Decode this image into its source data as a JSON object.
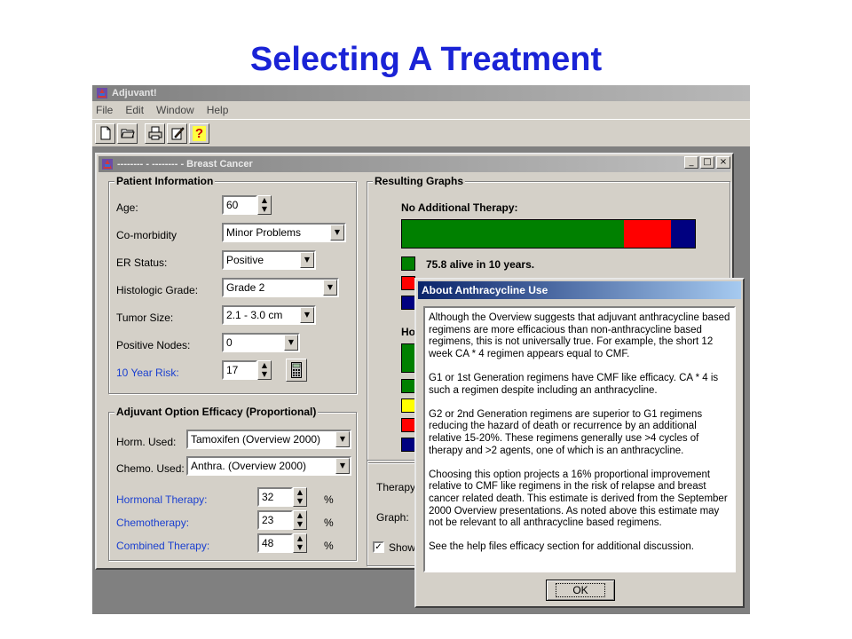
{
  "slide_title": "Selecting A Treatment",
  "app": {
    "title": "Adjuvant!",
    "menu": [
      "File",
      "Edit",
      "Window",
      "Help"
    ],
    "toolbar": [
      "new-file-icon",
      "open-file-icon",
      "print-icon",
      "edit-icon",
      "help-icon"
    ],
    "toolbar_help_glyph": "?"
  },
  "doc": {
    "title": "-------- - -------- - Breast Cancer",
    "win_buttons": [
      "_",
      "□",
      "×"
    ]
  },
  "patient": {
    "group_label": "Patient Information",
    "age_label": "Age:",
    "age": "60",
    "comorbidity_label": "Co-morbidity",
    "comorbidity": "Minor Problems",
    "er_label": "ER Status:",
    "er": "Positive",
    "grade_label": "Histologic Grade:",
    "grade": "Grade 2",
    "tumor_label": "Tumor Size:",
    "tumor": "2.1 - 3.0 cm",
    "nodes_label": "Positive Nodes:",
    "nodes": "0",
    "risk_label": "10 Year Risk:",
    "risk": "17"
  },
  "efficacy": {
    "group_label": "Adjuvant Option Efficacy (Proportional)",
    "horm_used_label": "Horm. Used:",
    "horm_used": "Tamoxifen (Overview 2000)",
    "chemo_used_label": "Chemo. Used:",
    "chemo_used": "Anthra. (Overview 2000)",
    "hormonal_label": "Hormonal Therapy:",
    "hormonal": "32",
    "chemo_label": "Chemotherapy:",
    "chemo": "23",
    "combined_label": "Combined Therapy:",
    "combined": "48",
    "pct": "%"
  },
  "graphs": {
    "group_label": "Resulting Graphs",
    "no_therapy_label": "No Additional Therapy:",
    "segments": [
      {
        "value": 75.8,
        "color": "#008000"
      },
      {
        "value": 15.9,
        "color": "#ff0000"
      },
      {
        "value": 8.3,
        "color": "#000080"
      }
    ],
    "alive_text": "75.8 alive in 10 years.",
    "with_therapy_label_partial": "Ho",
    "legend_colors": [
      "#008000",
      "#ff0000",
      "#000080"
    ],
    "legend2_colors": [
      "#008000",
      "#008000",
      "#ffff00",
      "#ff0000",
      "#000080"
    ],
    "therapy_label_partial": "Therapy",
    "graph_label": "Graph:",
    "show_label_partial": "Show",
    "show_checked": true
  },
  "dialog": {
    "title": "About Anthracycline Use",
    "paragraphs": [
      "Although the Overview suggests that adjuvant anthracycline based regimens are more efficacious than non-anthracycline based regimens, this is not universally true. For example, the short 12 week CA * 4 regimen appears equal to CMF.",
      "G1 or 1st Generation regimens have CMF like efficacy. CA * 4 is such a regimen despite including an anthracycline.",
      "G2 or 2nd Generation regimens are superior to G1 regimens reducing the hazard of death or recurrence by an additional relative 15-20%. These regimens generally use >4 cycles of therapy and >2 agents, one of which is an anthracycline.",
      "Choosing this option projects a 16% proportional improvement relative to CMF like regimens in the risk of relapse and breast cancer related death. This estimate is derived from the September 2000 Overview presentations.  As noted above this estimate may not be relevant to all anthracycline based regimens.",
      "See the help files efficacy section for additional discussion."
    ],
    "ok_label": "OK"
  }
}
